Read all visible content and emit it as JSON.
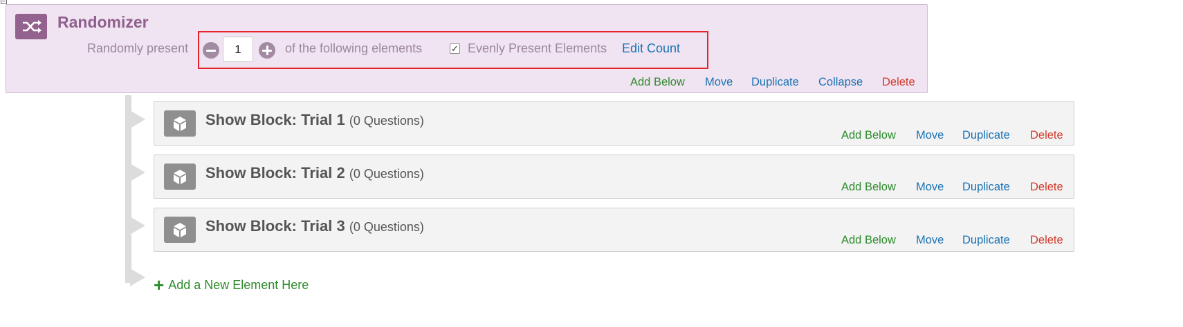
{
  "randomizer": {
    "title": "Randomizer",
    "icon": "shuffle-icon",
    "prefix": "Randomly present",
    "count_value": "1",
    "suffix": "of the following elements",
    "evenly_checked": true,
    "evenly_label": "Evenly Present Elements",
    "edit_count": "Edit Count",
    "actions": {
      "add_below": "Add Below",
      "move": "Move",
      "duplicate": "Duplicate",
      "collapse": "Collapse",
      "delete": "Delete"
    }
  },
  "blocks": [
    {
      "prefix": "Show Block: Trial 1",
      "count": "(0 Questions)"
    },
    {
      "prefix": "Show Block: Trial 2",
      "count": "(0 Questions)"
    },
    {
      "prefix": "Show Block: Trial 3",
      "count": "(0 Questions)"
    }
  ],
  "block_actions": {
    "add_below": "Add Below",
    "move": "Move",
    "duplicate": "Duplicate",
    "delete": "Delete"
  },
  "add_new_element": "Add a New Element Here",
  "colors": {
    "randomizer_bg": "#f1e4f2",
    "randomizer_accent": "#8f5f8d",
    "action_green": "#2c8b2b",
    "action_blue": "#1a72b3",
    "action_red": "#d23a2b",
    "highlight": "#e4232c"
  }
}
